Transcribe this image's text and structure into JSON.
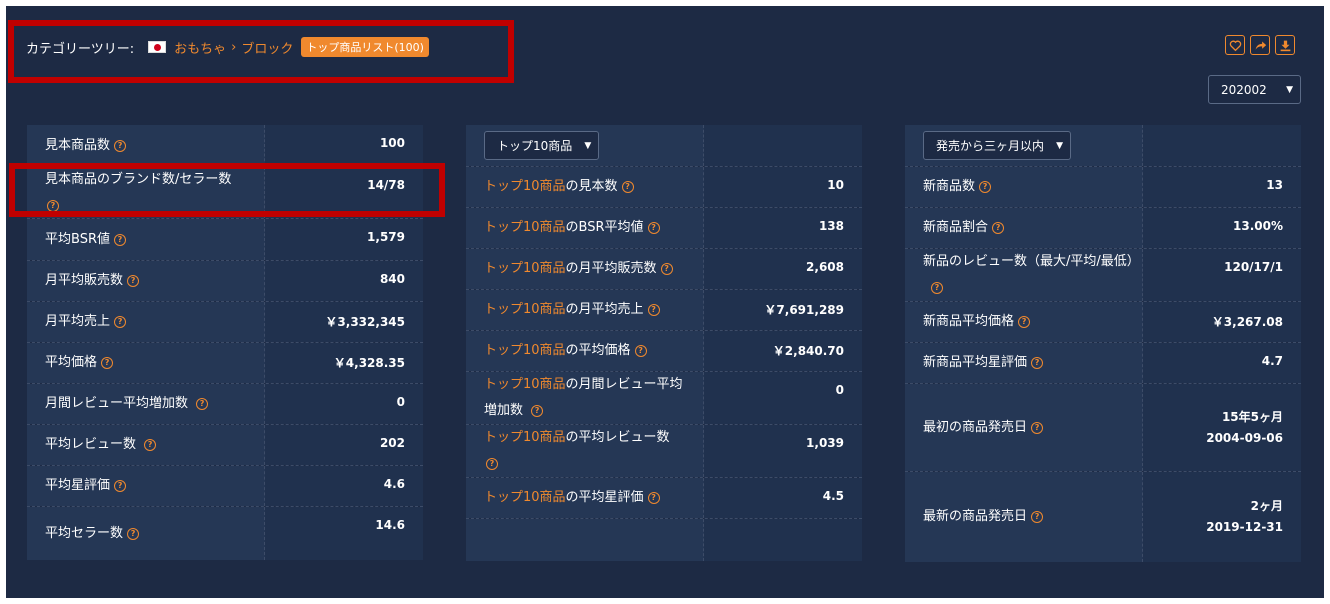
{
  "breadcrumb": {
    "label": "カテゴリーツリー:",
    "path1": "おもちゃ",
    "separator": "›",
    "path2": "ブロック",
    "badge": "トップ商品リスト(100)"
  },
  "actions": [
    "heart-icon",
    "share-icon",
    "download-icon"
  ],
  "month_select": "202002",
  "colors": {
    "background": "#1d2a44",
    "accent": "#f0892e",
    "highlight": "#c00000"
  },
  "panel1": {
    "rows": [
      {
        "label": "見本商品数",
        "value": "100"
      },
      {
        "label": "見本商品のブランド数/セラー数",
        "value": "14/78"
      },
      {
        "label": "平均BSR値",
        "value": "1,579"
      },
      {
        "label": "月平均販売数",
        "value": "840"
      },
      {
        "label": "月平均売上",
        "value": "￥3,332,345"
      },
      {
        "label": "平均価格",
        "value": "￥4,328.35"
      },
      {
        "label": "月間レビュー平均増加数",
        "value": "0"
      },
      {
        "label": "平均レビュー数",
        "value": "202"
      },
      {
        "label": "平均星評価",
        "value": "4.6"
      },
      {
        "label": "平均セラー数",
        "value": "14.6"
      }
    ]
  },
  "panel2": {
    "select": "トップ10商品",
    "prefix": "トップ10商品",
    "rows": [
      {
        "label": "の見本数",
        "value": "10"
      },
      {
        "label": "のBSR平均値",
        "value": "138"
      },
      {
        "label": "の月平均販売数",
        "value": "2,608"
      },
      {
        "label": "の月平均売上",
        "value": "￥7,691,289"
      },
      {
        "label": "の平均価格",
        "value": "￥2,840.70"
      },
      {
        "label": "の月間レビュー平均増加数",
        "value": "0"
      },
      {
        "label": "の平均レビュー数",
        "value": "1,039"
      },
      {
        "label": "の平均星評価",
        "value": "4.5"
      }
    ]
  },
  "panel3": {
    "select": "発売から三ヶ月以内",
    "rows": [
      {
        "label": "新商品数",
        "value": "13"
      },
      {
        "label": "新商品割合",
        "value": "13.00%"
      },
      {
        "label": "新品のレビュー数（最大/平均/最低）",
        "value": "120/17/1"
      },
      {
        "label": "新商品平均価格",
        "value": "￥3,267.08"
      },
      {
        "label": "新商品平均星評価",
        "value": "4.7"
      },
      {
        "label": "最初の商品発売日",
        "value": "15年5ヶ月",
        "value2": "2004-09-06"
      },
      {
        "label": "最新の商品発売日",
        "value": "2ヶ月",
        "value2": "2019-12-31"
      }
    ]
  }
}
